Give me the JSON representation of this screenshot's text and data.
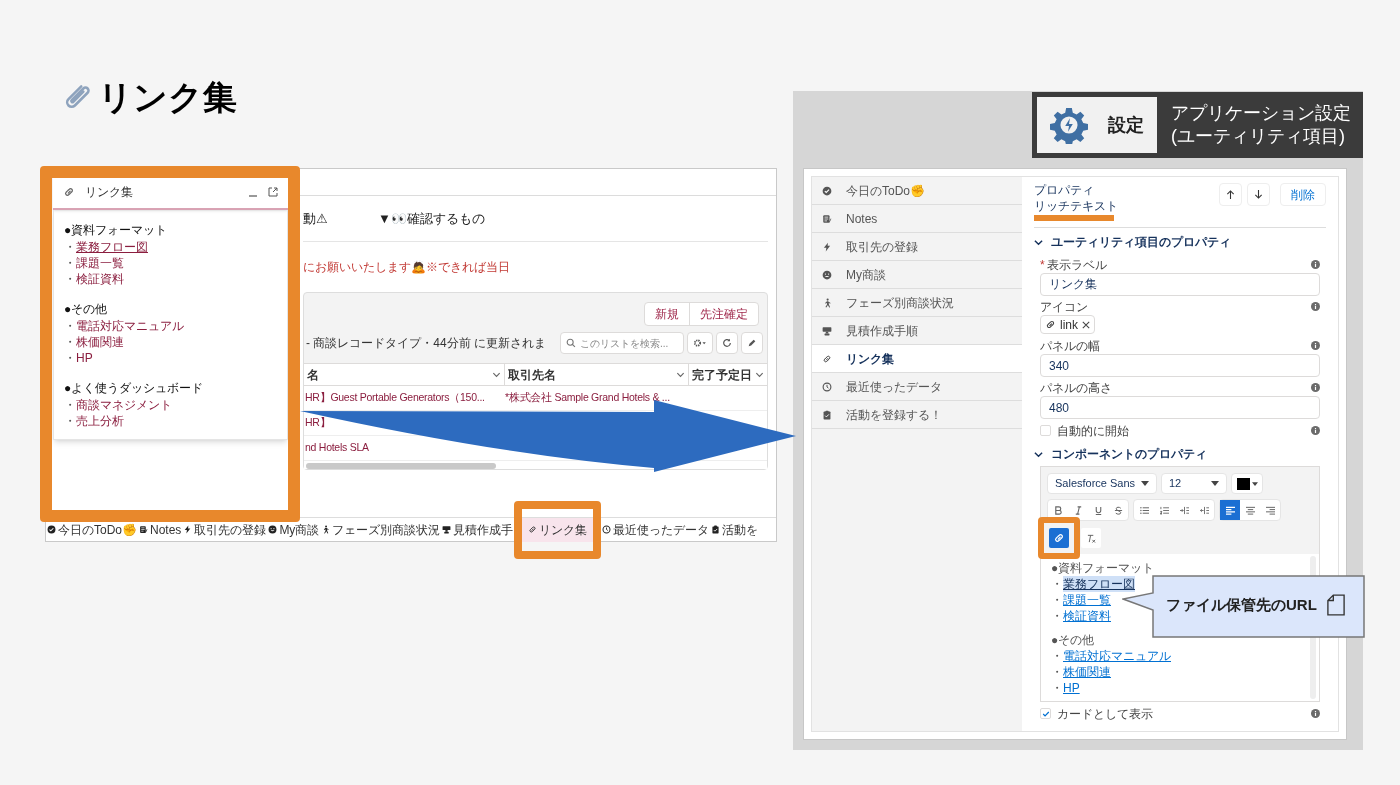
{
  "slide_title": "リンク集",
  "left_app": {
    "tabs": [
      {
        "label": "動⚠"
      },
      {
        "label": "▼👀確認するもの"
      }
    ],
    "notice": "にお願いいたします🙇※できれば当日",
    "list": {
      "buttons": [
        "新規",
        "先注確定"
      ],
      "info": "- 商談レコードタイプ・44分前 に更新されま",
      "search": {
        "placeholder": "このリストを検索..."
      },
      "columns": [
        "名",
        "取引先名",
        "完了予定日"
      ],
      "rows": [
        [
          "HR】Guest Portable Generators（150...",
          "*株式会社 Sample Grand Hotels & ..."
        ],
        [
          "HR】"
        ],
        [
          "nd Hotels SLA"
        ]
      ]
    },
    "utility_bar": [
      {
        "label": "今日のToDo✊",
        "selected": false
      },
      {
        "label": "Notes",
        "selected": false
      },
      {
        "label": "取引先の登録",
        "selected": false
      },
      {
        "label": "My商談",
        "selected": false
      },
      {
        "label": "フェーズ別商談状況",
        "selected": false
      },
      {
        "label": "見積作成手",
        "selected": false
      },
      {
        "label": "リンク集",
        "selected": true
      },
      {
        "label": "最近使ったデータ",
        "selected": false
      },
      {
        "label": "活動を",
        "selected": false
      }
    ]
  },
  "link_panel": {
    "title": "リンク集",
    "sections": [
      {
        "heading": "●資料フォーマット",
        "links": [
          {
            "bullet": "・",
            "text": "業務フロー図",
            "underlined": true
          },
          {
            "bullet": "・",
            "text": "課題一覧",
            "underlined": false
          },
          {
            "bullet": "・",
            "text": "検証資料",
            "underlined": false
          }
        ]
      },
      {
        "heading": "●その他",
        "links": [
          {
            "bullet": "・",
            "text": "電話対応マニュアル",
            "underlined": false
          },
          {
            "bullet": "・",
            "text": "株価関連",
            "underlined": false
          },
          {
            "bullet": "・",
            "text": "HP",
            "underlined": false
          }
        ]
      },
      {
        "heading": "●よく使うダッシュボード",
        "links": [
          {
            "bullet": "・",
            "text": "商談マネジメント",
            "underlined": false
          },
          {
            "bullet": "・",
            "text": "売上分析",
            "underlined": false
          }
        ]
      }
    ]
  },
  "settings": {
    "badge": "設定",
    "title_lines": [
      "アプリケーション設定",
      "(ユーティリティ項目)"
    ],
    "nav": [
      {
        "label": "今日のToDo✊",
        "selected": false
      },
      {
        "label": "Notes",
        "selected": false
      },
      {
        "label": "取引先の登録",
        "selected": false
      },
      {
        "label": "My商談",
        "selected": false
      },
      {
        "label": "フェーズ別商談状況",
        "selected": false
      },
      {
        "label": "見積作成手順",
        "selected": false
      },
      {
        "label": "リンク集",
        "selected": true
      },
      {
        "label": "最近使ったデータ",
        "selected": false
      },
      {
        "label": "活動を登録する！",
        "selected": false
      }
    ],
    "properties": {
      "caption": "プロパティ",
      "type": "リッチテキスト",
      "delete": "削除",
      "utility_section": "ユーティリティ項目のプロパティ",
      "label_field": {
        "required_mark": "*",
        "label": "表示ラベル",
        "value": "リンク集"
      },
      "icon_field": {
        "label": "アイコン",
        "value": "link"
      },
      "width_field": {
        "label": "パネルの幅",
        "value": "340"
      },
      "height_field": {
        "label": "パネルの高さ",
        "value": "480"
      },
      "auto_start": {
        "label": "自動的に開始",
        "checked": false
      },
      "component_section": "コンポーネントのプロパティ",
      "editor": {
        "font": "Salesforce Sans",
        "size": "12",
        "sections": [
          {
            "heading": "●資料フォーマット",
            "links": [
              {
                "bullet": "・",
                "text": "業務フロー図",
                "selected": true
              },
              {
                "bullet": "・",
                "text": "課題一覧",
                "selected": false
              },
              {
                "bullet": "・",
                "text": "検証資料",
                "selected": false
              }
            ]
          },
          {
            "heading": "●その他",
            "links": [
              {
                "bullet": "・",
                "text": "電話対応マニュアル",
                "selected": false
              },
              {
                "bullet": "・",
                "text": "株価関連",
                "selected": false
              },
              {
                "bullet": "・",
                "text": "HP",
                "selected": false
              }
            ]
          }
        ]
      },
      "show_as_card": {
        "label": "カードとして表示",
        "checked": true
      }
    },
    "callout": "ファイル保管先のURL"
  }
}
